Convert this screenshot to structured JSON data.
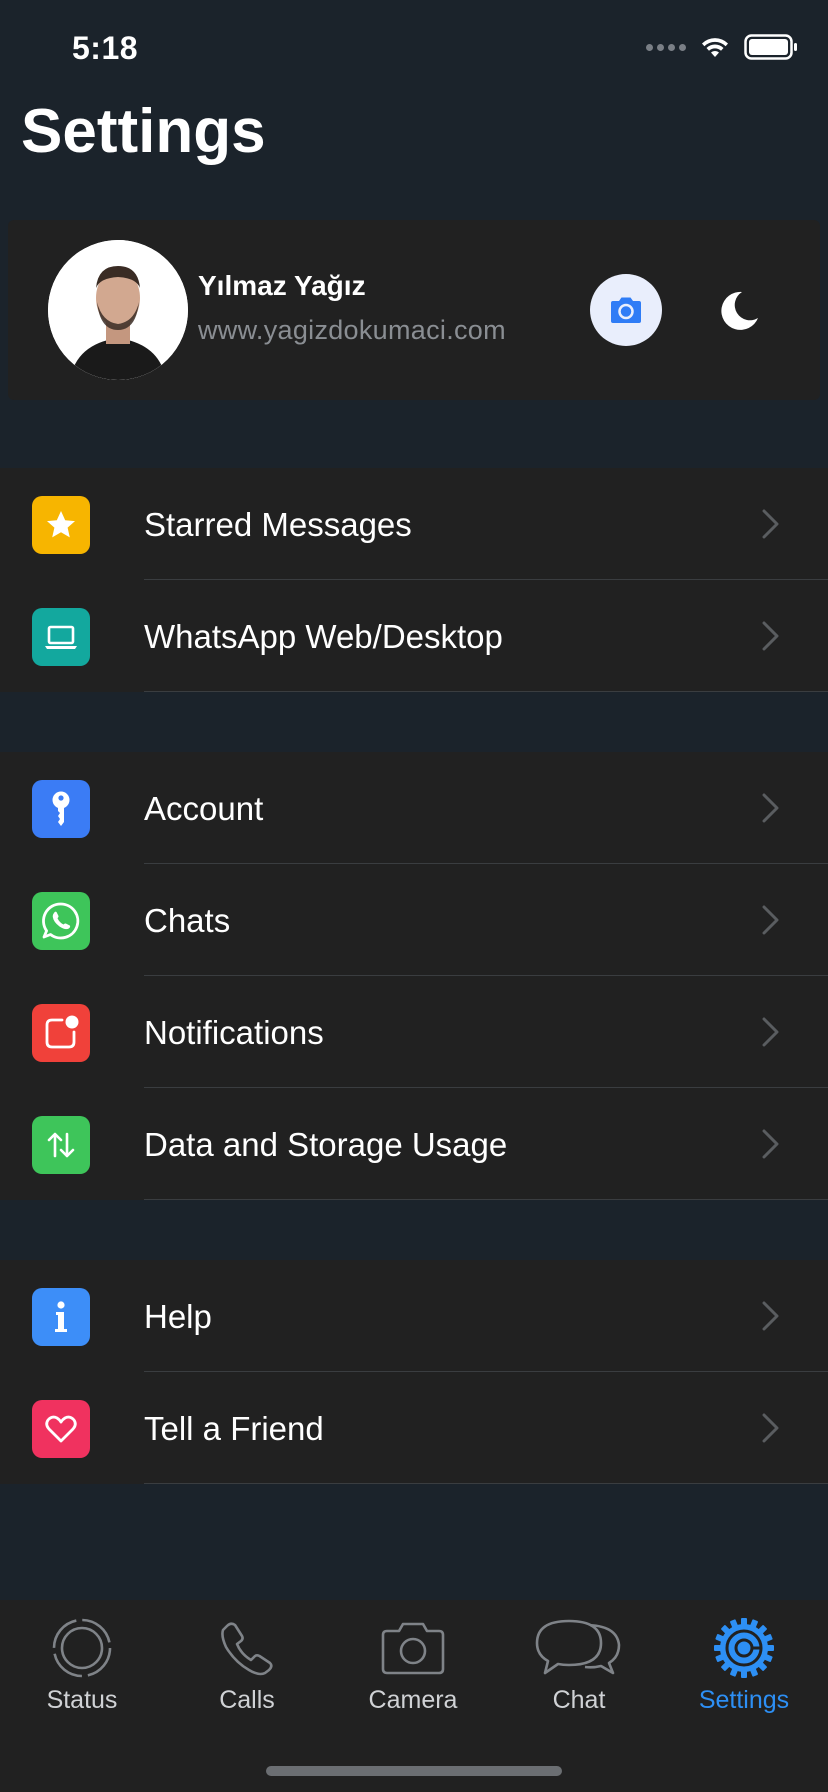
{
  "status_bar": {
    "time": "5:18"
  },
  "page": {
    "title": "Settings"
  },
  "profile": {
    "name": "Yılmaz Yağız",
    "url": "www.yagizdokumaci.com"
  },
  "groups": [
    {
      "items": [
        {
          "label": "Starred Messages",
          "icon": "star-icon",
          "color": "#f7b500"
        },
        {
          "label": "WhatsApp Web/Desktop",
          "icon": "laptop-icon",
          "color": "#13a89e"
        }
      ]
    },
    {
      "items": [
        {
          "label": "Account",
          "icon": "key-icon",
          "color": "#3b7cf5"
        },
        {
          "label": "Chats",
          "icon": "whatsapp-icon",
          "color": "#3ec55a"
        },
        {
          "label": "Notifications",
          "icon": "notification-icon",
          "color": "#f0413a"
        },
        {
          "label": "Data and Storage Usage",
          "icon": "arrows-updown-icon",
          "color": "#3ec55a"
        }
      ]
    },
    {
      "items": [
        {
          "label": "Help",
          "icon": "info-icon",
          "color": "#3d8ef8"
        },
        {
          "label": "Tell a Friend",
          "icon": "heart-icon",
          "color": "#f0325f"
        }
      ]
    }
  ],
  "tabs": [
    {
      "label": "Status",
      "icon": "status-icon",
      "active": false
    },
    {
      "label": "Calls",
      "icon": "phone-icon",
      "active": false
    },
    {
      "label": "Camera",
      "icon": "camera-icon",
      "active": false
    },
    {
      "label": "Chat",
      "icon": "chat-bubbles-icon",
      "active": false
    },
    {
      "label": "Settings",
      "icon": "gear-icon",
      "active": true
    }
  ],
  "colors": {
    "accent": "#2d8ff4",
    "background": "#1b232b",
    "card": "#212121"
  }
}
